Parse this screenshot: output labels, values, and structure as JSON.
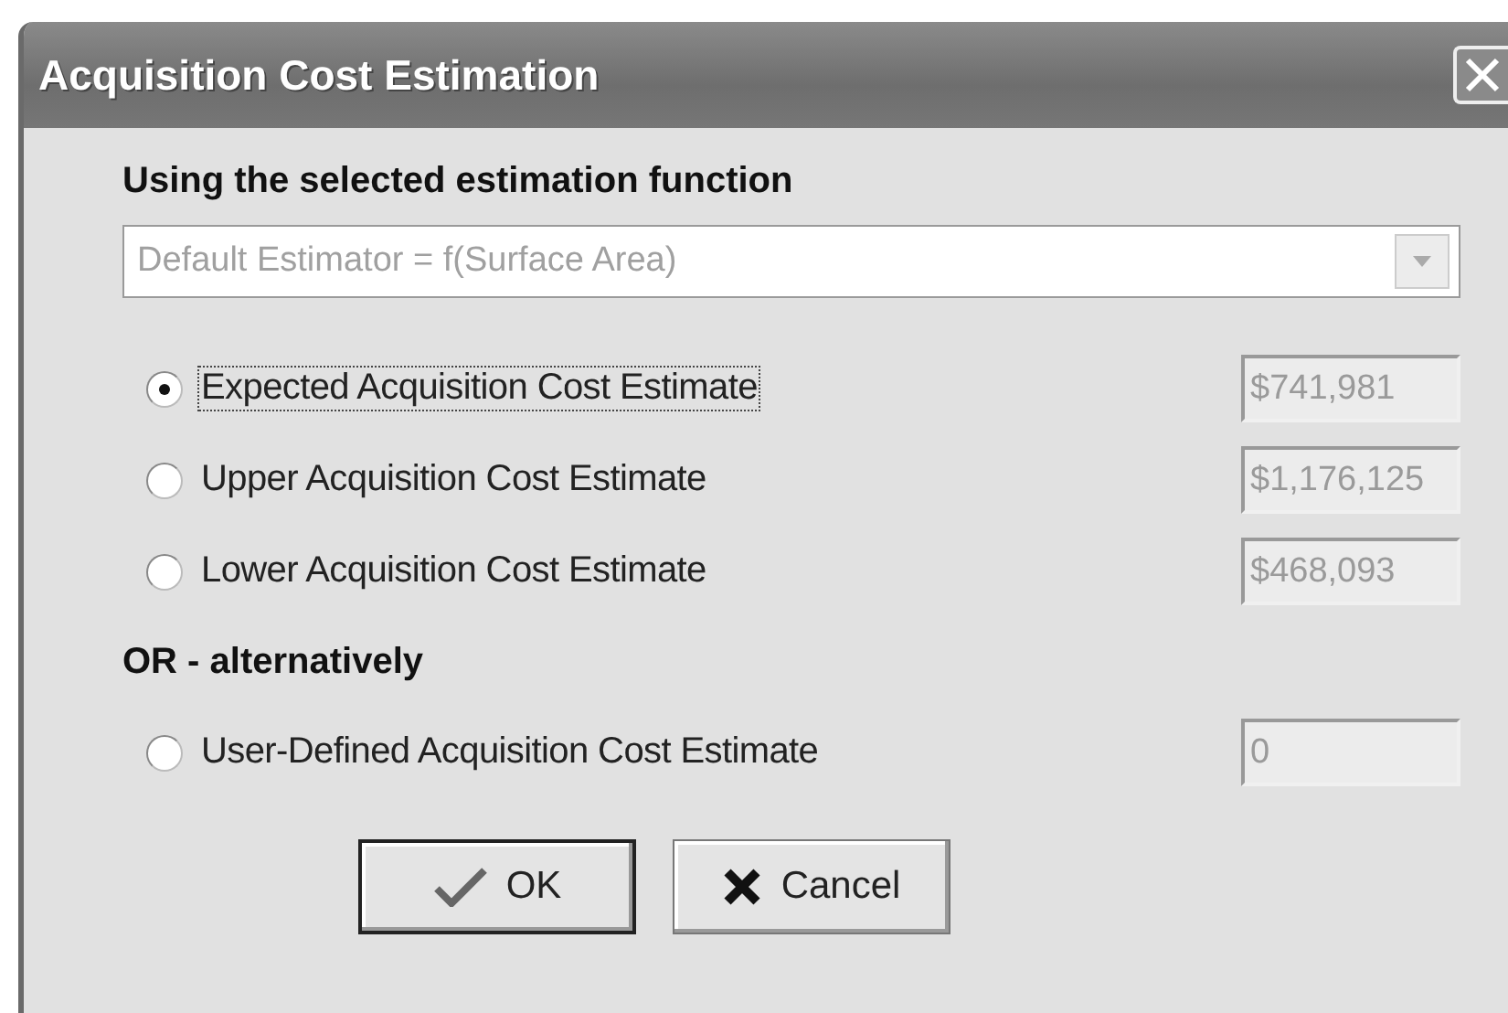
{
  "window": {
    "title": "Acquisition Cost Estimation"
  },
  "estimation": {
    "heading": "Using the selected estimation function",
    "function": {
      "value": "Default Estimator = f(Surface Area)",
      "disabled": true
    }
  },
  "options": [
    {
      "label": "Expected Acquisition Cost Estimate",
      "value": "$741,981",
      "selected": true,
      "focused": true,
      "value_disabled": true
    },
    {
      "label": "Upper Acquisition Cost Estimate",
      "value": "$1,176,125",
      "selected": false,
      "focused": false,
      "value_disabled": true
    },
    {
      "label": "Lower Acquisition Cost Estimate",
      "value": "$468,093",
      "selected": false,
      "focused": false,
      "value_disabled": true
    }
  ],
  "alternative": {
    "heading": "OR - alternatively",
    "option": {
      "label": "User-Defined Acquisition Cost Estimate",
      "value": "0",
      "selected": false,
      "focused": false,
      "value_disabled": true
    }
  },
  "buttons": [
    {
      "label": "OK",
      "kind": "ok",
      "default": true
    },
    {
      "label": "Cancel",
      "kind": "cancel",
      "default": false
    }
  ]
}
